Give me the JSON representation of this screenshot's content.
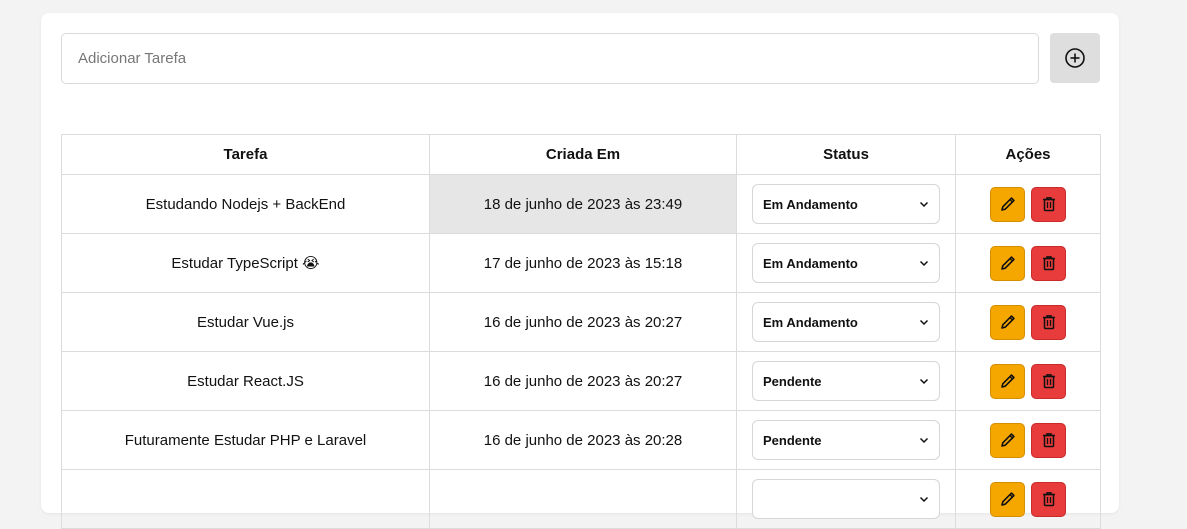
{
  "input": {
    "placeholder": "Adicionar Tarefa",
    "value": ""
  },
  "add_button_icon": "plus-circle-icon",
  "table": {
    "headers": {
      "task": "Tarefa",
      "created": "Criada Em",
      "status": "Status",
      "actions": "Ações"
    },
    "rows": [
      {
        "task": "Estudando Nodejs + BackEnd",
        "created": "18 de junho de 2023 às 23:49",
        "status": "Em Andamento"
      },
      {
        "task": "Estudar TypeScript 😭",
        "created": "17 de junho de 2023 às 15:18",
        "status": "Em Andamento"
      },
      {
        "task": "Estudar Vue.js",
        "created": "16 de junho de 2023 às 20:27",
        "status": "Em Andamento"
      },
      {
        "task": "Estudar React.JS",
        "created": "16 de junho de 2023 às 20:27",
        "status": "Pendente"
      },
      {
        "task": "Futuramente Estudar PHP e Laravel",
        "created": "16 de junho de 2023 às 20:28",
        "status": "Pendente"
      },
      {
        "task": "",
        "created": "",
        "status": ""
      }
    ]
  },
  "colors": {
    "edit": "#f5a700",
    "delete": "#e83b3b",
    "highlight_cell": "#e6e6e6"
  }
}
